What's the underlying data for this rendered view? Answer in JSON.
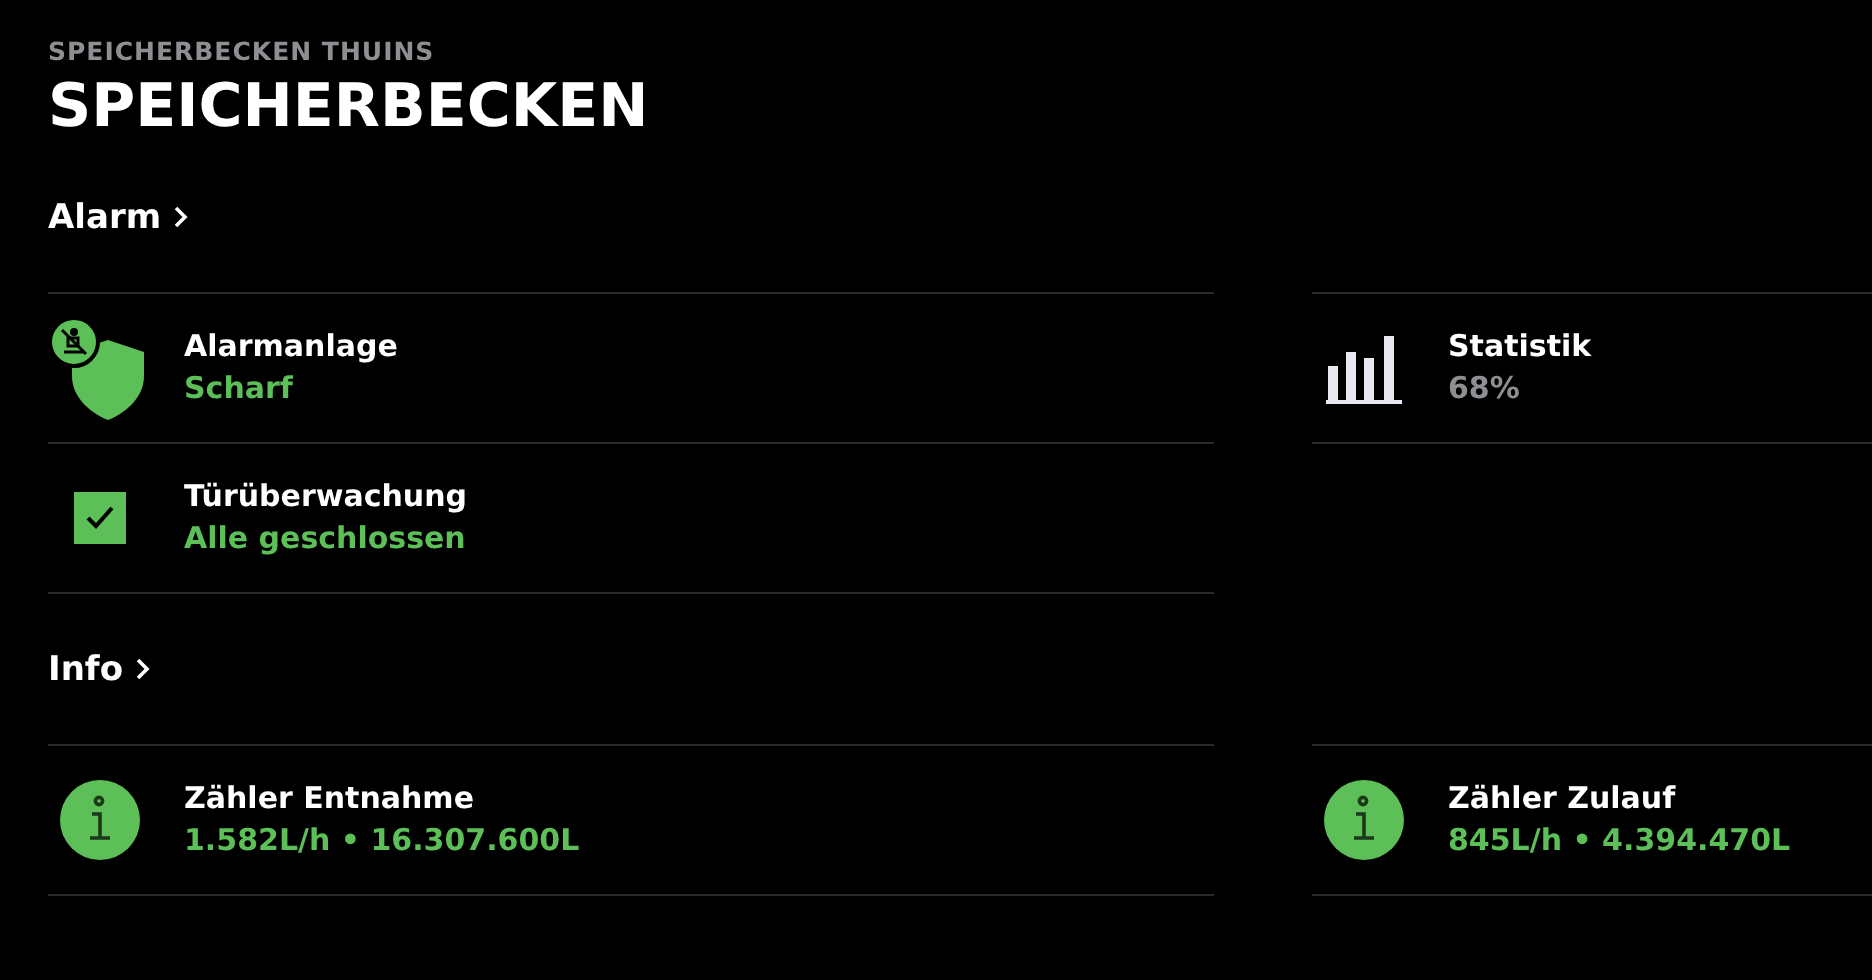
{
  "header": {
    "subtitle": "SPEICHERBECKEN THUINS",
    "title": "SPEICHERBECKEN"
  },
  "sections": [
    {
      "title": "Alarm",
      "columns": [
        [
          {
            "kind": "shield",
            "title": "Alarmanlage",
            "status": "Scharf",
            "color": "#5cbf57"
          },
          {
            "kind": "check",
            "title": "Türüberwachung",
            "status": "Alle geschlossen",
            "color": "#5cbf57"
          }
        ],
        [
          {
            "kind": "chart",
            "title": "Statistik",
            "status": "68%",
            "color": "#8e8e93"
          }
        ]
      ]
    },
    {
      "title": "Info",
      "columns": [
        [
          {
            "kind": "info",
            "title": "Zähler Entnahme",
            "status": "1.582L/h • 16.307.600L",
            "color": "#5cbf57"
          }
        ],
        [
          {
            "kind": "info",
            "title": "Zähler Zulauf",
            "status": "845L/h • 4.394.470L",
            "color": "#5cbf57"
          }
        ]
      ]
    }
  ]
}
